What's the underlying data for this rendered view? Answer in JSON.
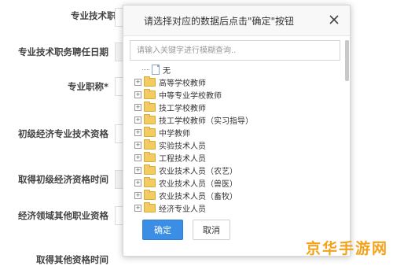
{
  "form": {
    "labels": [
      "专业技术职务*",
      "专业技术职务聘任日期",
      "专业职称*",
      "初级经济专业技术资格",
      "取得初级经济资格时间",
      "经济领域其他职业资格",
      "取得其他资格时间"
    ]
  },
  "dialog": {
    "title": "请选择对应的数据后点击\"确定\"按钮",
    "search_placeholder": "请输入关键字进行模糊查询..",
    "tree": [
      {
        "label": "无",
        "type": "file"
      },
      {
        "label": "高等学校教师",
        "type": "folder"
      },
      {
        "label": "中等专业学校教师",
        "type": "folder"
      },
      {
        "label": "技工学校教师",
        "type": "folder"
      },
      {
        "label": "技工学校教师（实习指导）",
        "type": "folder"
      },
      {
        "label": "中学教师",
        "type": "folder"
      },
      {
        "label": "实验技术人员",
        "type": "folder"
      },
      {
        "label": "工程技术人员",
        "type": "folder"
      },
      {
        "label": "农业技术人员（农艺）",
        "type": "folder"
      },
      {
        "label": "农业技术人员（兽医）",
        "type": "folder"
      },
      {
        "label": "农业技术人员（畜牧）",
        "type": "folder"
      },
      {
        "label": "经济专业人员",
        "type": "folder"
      }
    ],
    "ok_label": "确定",
    "cancel_label": "取消"
  },
  "watermark": "京华手游网",
  "colors": {
    "primary": "#3a8ee6",
    "folder": "#f2cc62",
    "watermark": "#f5a21b"
  }
}
